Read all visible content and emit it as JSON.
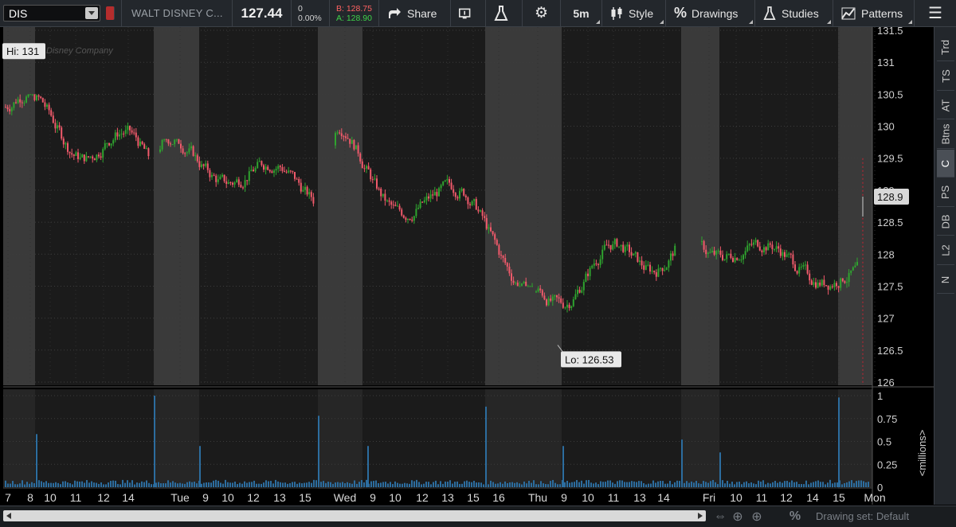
{
  "toolbar": {
    "symbol": "DIS",
    "company": "WALT DISNEY C...",
    "last": "127.44",
    "net_change": "0",
    "pct_change": "0.00%",
    "bid": "B: 128.75",
    "ask": "A: 128.90",
    "share_label": "Share",
    "timeframe_label": "5m",
    "style_label": "Style",
    "drawings_label": "Drawings",
    "studies_label": "Studies",
    "patterns_label": "Patterns"
  },
  "right_tabs": [
    "Trd",
    "TS",
    "AT",
    "Btns",
    "C",
    "PS",
    "DB",
    "L2",
    "N"
  ],
  "right_tab_active": "C",
  "chart_data": {
    "type": "candlestick",
    "watermark": "Disney Company",
    "price_axis": {
      "ticks": [
        "131.5",
        "131",
        "130.5",
        "130",
        "129.5",
        "129",
        "128.5",
        "128",
        "127.5",
        "127",
        "126.5",
        "126"
      ],
      "range": [
        125.95,
        131.55
      ]
    },
    "hi_label": "Hi: 131",
    "lo_label": "Lo: 126.53",
    "current_price_label": "128.9",
    "volume_axis": {
      "ticks": [
        "1",
        "0.75",
        "0.5",
        "0.25",
        "0"
      ],
      "label": "<millions>"
    },
    "x_tick_labels": [
      "7",
      "8",
      "10",
      "11",
      "12",
      "14",
      "Tue",
      "9",
      "10",
      "12",
      "13",
      "15",
      "Wed",
      "9",
      "10",
      "12",
      "13",
      "15",
      "16",
      "Thu",
      "9",
      "10",
      "11",
      "13",
      "14",
      "Fri",
      "10",
      "11",
      "12",
      "14",
      "15",
      "Mon"
    ],
    "days": [
      {
        "day": "Mon",
        "open": 130.3,
        "close": 129.4,
        "high": 130.5,
        "low": 128.5
      },
      {
        "day": "Tue",
        "open": 129.6,
        "close": 129.0,
        "high": 129.8,
        "low": 128.4
      },
      {
        "day": "Wed",
        "open": 129.7,
        "close": 127.8,
        "high": 130.2,
        "low": 127.5
      },
      {
        "day": "Thu",
        "open": 127.4,
        "close": 128.2,
        "high": 128.4,
        "low": 126.53
      },
      {
        "day": "Fri",
        "open": 128.2,
        "close": 127.6,
        "high": 128.3,
        "low": 127.2
      }
    ],
    "volume_spikes_millions": [
      0.58,
      1.0,
      0.45,
      0.78,
      0.45,
      0.88,
      0.45,
      0.52,
      0.38,
      0.98
    ],
    "colors": {
      "up": "#2fa42f",
      "down": "#f05a6b",
      "volume": "#2c6d9f",
      "background": "#1b1b1b",
      "session_shade": "#3a3a3a"
    },
    "grid": true
  },
  "statusbar": {
    "drawing_set": "Drawing set: Default"
  }
}
